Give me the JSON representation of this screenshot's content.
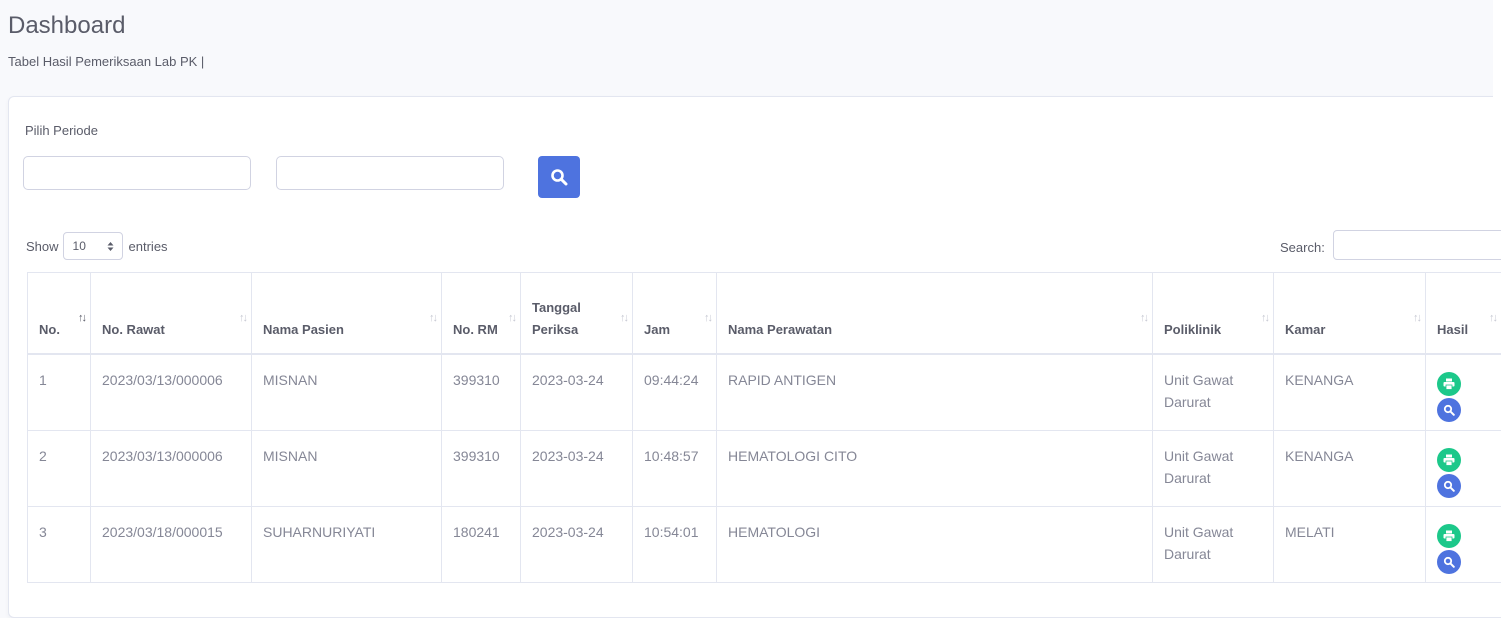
{
  "header": {
    "title": "Dashboard",
    "subtitle": "Tabel Hasil Pemeriksaan Lab PK |"
  },
  "filter": {
    "periode_label": "Pilih Periode",
    "start_date": "",
    "end_date": ""
  },
  "table_controls": {
    "show_label": "Show",
    "page_length": "10",
    "entries_label": "entries",
    "search_label": "Search:",
    "search_value": ""
  },
  "table": {
    "columns": [
      {
        "label": "No.",
        "sort": "asc"
      },
      {
        "label": "No. Rawat",
        "sort": "none"
      },
      {
        "label": "Nama Pasien",
        "sort": "none"
      },
      {
        "label": "No. RM",
        "sort": "none"
      },
      {
        "label": "Tanggal Periksa",
        "sort": "none"
      },
      {
        "label": "Jam",
        "sort": "none"
      },
      {
        "label": "Nama Perawatan",
        "sort": "none"
      },
      {
        "label": "Poliklinik",
        "sort": "none"
      },
      {
        "label": "Kamar",
        "sort": "none"
      },
      {
        "label": "Hasil",
        "sort": "none"
      }
    ],
    "rows": [
      {
        "no": "1",
        "no_rawat": "2023/03/13/000006",
        "nama_pasien": "MISNAN",
        "no_rm": "399310",
        "tanggal": "2023-03-24",
        "jam": "09:44:24",
        "perawatan": "RAPID ANTIGEN",
        "poliklinik": "Unit Gawat Darurat",
        "kamar": "KENANGA"
      },
      {
        "no": "2",
        "no_rawat": "2023/03/13/000006",
        "nama_pasien": "MISNAN",
        "no_rm": "399310",
        "tanggal": "2023-03-24",
        "jam": "10:48:57",
        "perawatan": "HEMATOLOGI CITO",
        "poliklinik": "Unit Gawat Darurat",
        "kamar": "KENANGA"
      },
      {
        "no": "3",
        "no_rawat": "2023/03/18/000015",
        "nama_pasien": "SUHARNURIYATI",
        "no_rm": "180241",
        "tanggal": "2023-03-24",
        "jam": "10:54:01",
        "perawatan": "HEMATOLOGI",
        "poliklinik": "Unit Gawat Darurat",
        "kamar": "MELATI"
      }
    ]
  },
  "icons": {
    "search": "search-icon",
    "print": "print-icon",
    "view": "magnifier-icon",
    "sort": "sort-arrows-icon",
    "select_caret": "select-caret-icon"
  },
  "colors": {
    "primary": "#4e73df",
    "success": "#1cc88a",
    "text": "#858796",
    "heading": "#5a5c69",
    "border": "#e3e6f0"
  }
}
